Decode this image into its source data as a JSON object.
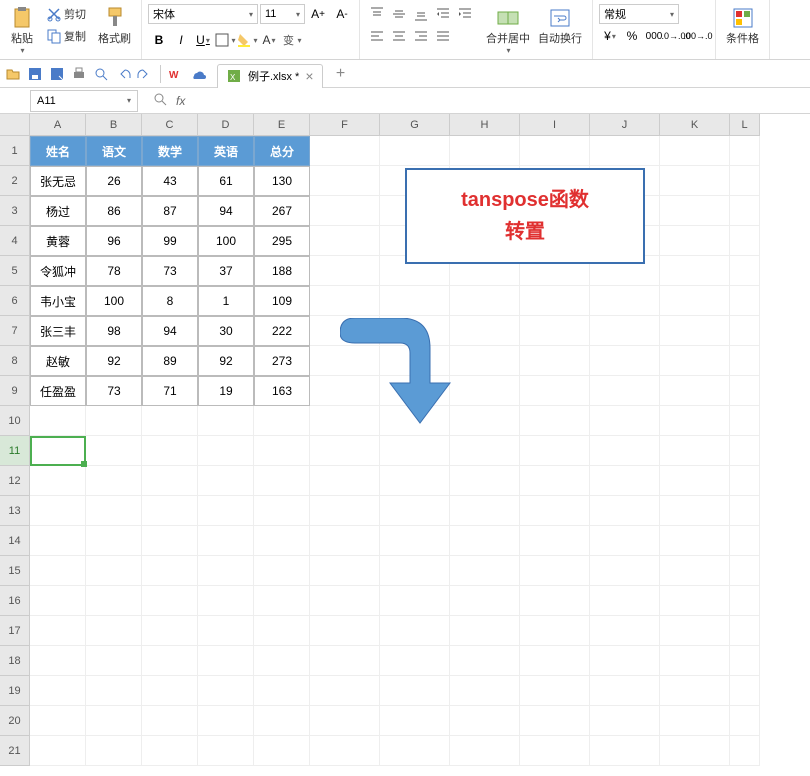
{
  "ribbon": {
    "paste": "粘贴",
    "cut": "剪切",
    "copy": "复制",
    "format_painter": "格式刷",
    "font_name": "宋体",
    "font_size": "11",
    "bold": "B",
    "italic": "I",
    "underline": "U",
    "merge_center": "合并居中",
    "wrap_text": "自动换行",
    "number_format": "常规",
    "cond_format": "条件格"
  },
  "doc": {
    "tab_title": "例子.xlsx *",
    "add": "+"
  },
  "namebox": "A11",
  "fx_label": "fx",
  "columns": [
    "A",
    "B",
    "C",
    "D",
    "E",
    "F",
    "G",
    "H",
    "I",
    "J",
    "K",
    "L"
  ],
  "row_numbers": [
    1,
    2,
    3,
    4,
    5,
    6,
    7,
    8,
    9,
    10,
    11,
    12,
    13,
    14,
    15,
    16,
    17,
    18,
    19,
    20,
    21
  ],
  "table": {
    "header": [
      "姓名",
      "语文",
      "数学",
      "英语",
      "总分"
    ],
    "rows": [
      [
        "张无忌",
        "26",
        "43",
        "61",
        "130"
      ],
      [
        "杨过",
        "86",
        "87",
        "94",
        "267"
      ],
      [
        "黄蓉",
        "96",
        "99",
        "100",
        "295"
      ],
      [
        "令狐冲",
        "78",
        "73",
        "37",
        "188"
      ],
      [
        "韦小宝",
        "100",
        "8",
        "1",
        "109"
      ],
      [
        "张三丰",
        "98",
        "94",
        "30",
        "222"
      ],
      [
        "赵敏",
        "92",
        "89",
        "92",
        "273"
      ],
      [
        "任盈盈",
        "73",
        "71",
        "19",
        "163"
      ]
    ]
  },
  "annotation": {
    "line1": "tanspose函数",
    "line2": "转置"
  },
  "active_cell": "A11"
}
